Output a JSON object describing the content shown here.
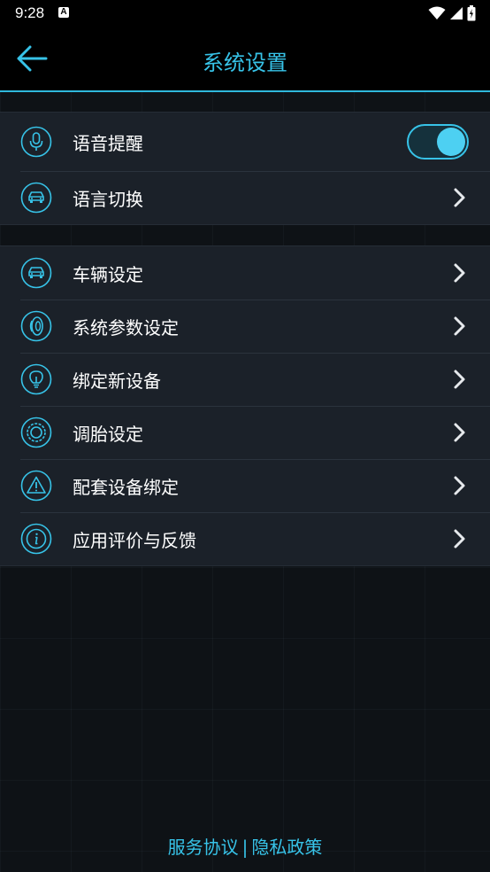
{
  "status_bar": {
    "time": "9:28",
    "notification_badge": "A"
  },
  "header": {
    "title": "系统设置",
    "back_icon": "arrow-left-icon"
  },
  "groups": [
    {
      "items": [
        {
          "label": "语音提醒",
          "icon": "microphone-icon",
          "control": "toggle",
          "toggle_on": true
        },
        {
          "label": "语言切换",
          "icon": "car-icon",
          "control": "chevron"
        }
      ]
    },
    {
      "items": [
        {
          "label": "车辆设定",
          "icon": "car-icon",
          "control": "chevron"
        },
        {
          "label": "系统参数设定",
          "icon": "tire-icon",
          "control": "chevron"
        },
        {
          "label": "绑定新设备",
          "icon": "lightbulb-icon",
          "control": "chevron"
        },
        {
          "label": "调胎设定",
          "icon": "wheel-icon",
          "control": "chevron"
        },
        {
          "label": "配套设备绑定",
          "icon": "warning-icon",
          "control": "chevron"
        },
        {
          "label": "应用评价与反馈",
          "icon": "info-icon",
          "control": "chevron"
        }
      ]
    }
  ],
  "footer": {
    "service_agreement": "服务协议",
    "separator": "|",
    "privacy_policy": "隐私政策"
  },
  "colors": {
    "accent": "#37c3e8",
    "background": "#0e1216",
    "row_background": "#1b2129"
  }
}
